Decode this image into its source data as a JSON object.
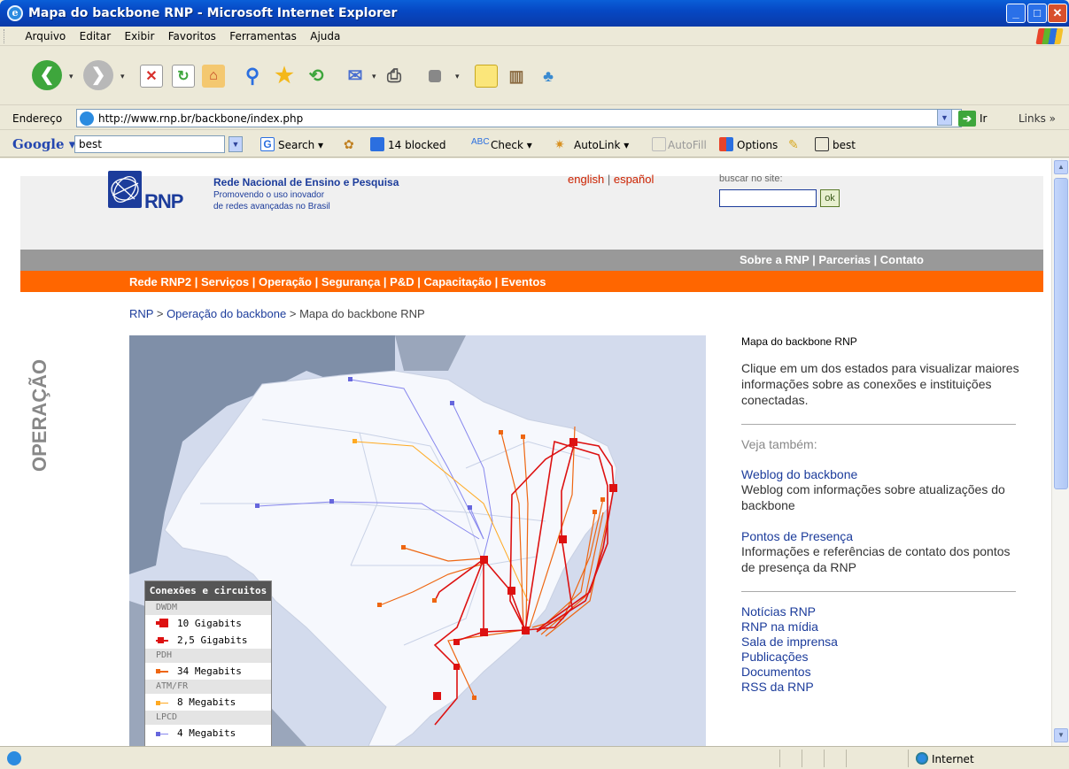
{
  "window": {
    "title": "Mapa do backbone RNP - Microsoft Internet Explorer"
  },
  "menu": [
    "Arquivo",
    "Editar",
    "Exibir",
    "Favoritos",
    "Ferramentas",
    "Ajuda"
  ],
  "address": {
    "label": "Endereço",
    "url": "http://www.rnp.br/backbone/index.php",
    "go_label": "Ir",
    "links_label": "Links"
  },
  "google": {
    "logo": "Google",
    "query": "best",
    "search": "Search",
    "blocked": "14 blocked",
    "check": "Check",
    "autolink": "AutoLink",
    "autofill": "AutoFill",
    "options": "Options",
    "best": "best"
  },
  "site": {
    "org_name": "Rede Nacional de Ensino e Pesquisa",
    "tagline_1": "Promovendo o uso inovador",
    "tagline_2": "de redes avançadas no Brasil",
    "logo_text": "RNP",
    "lang_english": "english",
    "lang_sep": "|",
    "lang_espanol": "español",
    "search_label": "buscar no site:",
    "search_btn": "ok",
    "topnav": "Sobre a RNP | Parcerias | Contato",
    "mainnav": "Rede RNP2 | Serviços | Operação | Segurança | P&D | Capacitação | Eventos",
    "section": "OPERAÇÃO"
  },
  "breadcrumb": {
    "root": "RNP",
    "sep1": ">",
    "parent": "Operação do backbone",
    "sep2": ">",
    "current": "Mapa do backbone RNP"
  },
  "legend": {
    "title": "Conexões e circuitos",
    "cat_dwdm": "DWDM",
    "item_10g": "10 Gigabits",
    "item_25g": "2,5 Gigabits",
    "cat_pdh": "PDH",
    "item_34m": "34 Megabits",
    "cat_atm": "ATM/FR",
    "item_8m": "8 Megabits",
    "cat_lpcd": "LPCD",
    "item_4m": "4 Megabits"
  },
  "sidebar": {
    "title": "Mapa do backbone RNP",
    "intro": "Clique em um dos estados para visualizar maiores informações sobre as conexões e instituições conectadas.",
    "see_also": "Veja também:",
    "link1": "Weblog do backbone",
    "desc1": "Weblog com informações sobre atualizações do backbone",
    "link2": "Pontos de Presença",
    "desc2": "Informações e referências de contato dos pontos de presença da RNP",
    "list": [
      "Notícias RNP",
      "RNP na mídia",
      "Sala de imprensa",
      "Publicações",
      "Documentos",
      "RSS da RNP"
    ]
  },
  "status": {
    "zone": "Internet"
  },
  "colors": {
    "rnp_blue": "#1c3c9b",
    "orange": "#ff6600",
    "dwdm_red": "#dd1111",
    "pdh_orange": "#ee6611",
    "atm_yellow": "#ffaa22",
    "lpcd_blue": "#8888ee"
  }
}
